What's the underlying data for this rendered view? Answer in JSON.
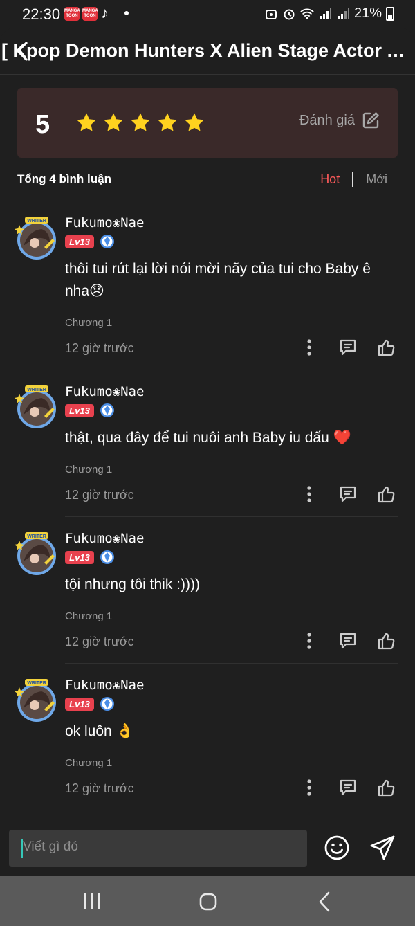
{
  "status_bar": {
    "time": "22:30",
    "app_icon_label": "MANGA TOON",
    "battery": "21%"
  },
  "header": {
    "title": "[ Kpop Demon Hunters X Alien Stage Actor Au..."
  },
  "rating": {
    "score": "5",
    "stars": 5,
    "rate_label": "Đánh giá",
    "star_color": "#ffd21f"
  },
  "comments_header": {
    "total": "Tổng 4 bình luận",
    "sort_hot": "Hot",
    "sort_new": "Mới",
    "active_color": "#ff5b5b"
  },
  "comments": [
    {
      "username": "Fukumo❀Nae",
      "level": "Lv13",
      "text": "thôi tui rút lại lời nói mời nãy của tui cho Baby ê nha😞",
      "chapter": "Chương 1",
      "time": "12 giờ trước"
    },
    {
      "username": "Fukumo❀Nae",
      "level": "Lv13",
      "text": "thật, qua đây để tui nuôi anh Baby iu dấu ❤️",
      "chapter": "Chương 1",
      "time": "12 giờ trước"
    },
    {
      "username": "Fukumo❀Nae",
      "level": "Lv13",
      "text": "tội nhưng tôi thik :))))",
      "chapter": "Chương 1",
      "time": "12 giờ trước"
    },
    {
      "username": "Fukumo❀Nae",
      "level": "Lv13",
      "text": "ok luôn 👌",
      "chapter": "Chương 1",
      "time": "12 giờ trước"
    }
  ],
  "input": {
    "placeholder": "Viết gì đó"
  }
}
